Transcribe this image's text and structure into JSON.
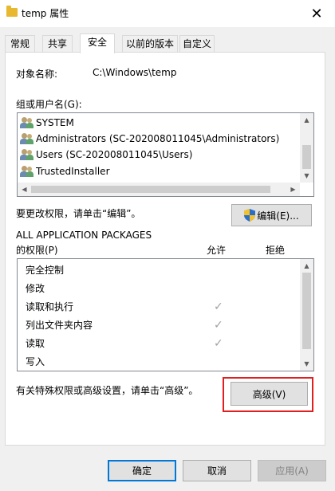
{
  "window": {
    "title": "temp 属性",
    "close_glyph": "✕"
  },
  "tabs": [
    {
      "label": "常规"
    },
    {
      "label": "共享"
    },
    {
      "label": "安全"
    },
    {
      "label": "以前的版本"
    },
    {
      "label": "自定义"
    }
  ],
  "security": {
    "object_name_label": "对象名称:",
    "object_name_value": "C:\\Windows\\temp",
    "groups_label": "组或用户名(G):",
    "users": [
      {
        "name": "SYSTEM"
      },
      {
        "name": "Administrators (SC-202008011045\\Administrators)"
      },
      {
        "name": "Users (SC-202008011045\\Users)"
      },
      {
        "name": "TrustedInstaller"
      }
    ],
    "edit_hint": "要更改权限，请单击“编辑”。",
    "edit_button": "编辑(E)...",
    "permissions_for_line1": "ALL APPLICATION PACKAGES",
    "permissions_for_line2": "的权限(P)",
    "allow_header": "允许",
    "deny_header": "拒绝",
    "permissions": [
      {
        "name": "完全控制",
        "allow": false,
        "deny": false
      },
      {
        "name": "修改",
        "allow": false,
        "deny": false
      },
      {
        "name": "读取和执行",
        "allow": true,
        "deny": false
      },
      {
        "name": "列出文件夹内容",
        "allow": true,
        "deny": false
      },
      {
        "name": "读取",
        "allow": true,
        "deny": false
      },
      {
        "name": "写入",
        "allow": false,
        "deny": false
      }
    ],
    "advanced_hint": "有关特殊权限或高级设置，请单击“高级”。",
    "advanced_button": "高级(V)"
  },
  "footer": {
    "ok": "确定",
    "cancel": "取消",
    "apply": "应用(A)"
  },
  "colors": {
    "highlight_box": "#e02020",
    "default_button_border": "#0078d7"
  },
  "icons": {
    "folder": "folder-icon",
    "user": "user-group-icon",
    "shield": "uac-shield-icon",
    "check": "checkmark-icon"
  }
}
